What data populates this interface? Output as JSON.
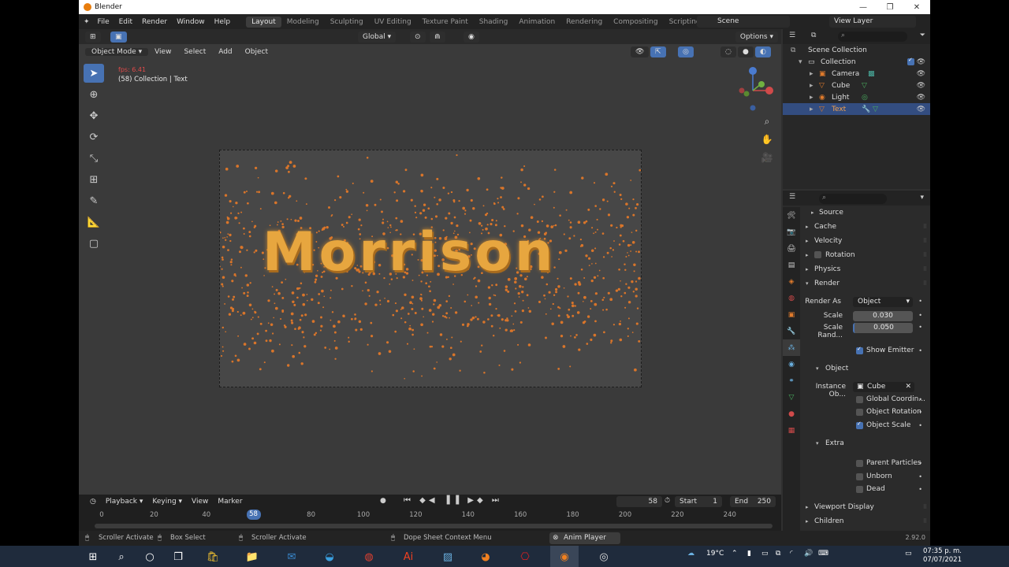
{
  "window": {
    "title": "Blender",
    "controls": [
      "—",
      "❐",
      "✕"
    ]
  },
  "menus": [
    "File",
    "Edit",
    "Render",
    "Window",
    "Help"
  ],
  "workspaces": [
    "Layout",
    "Modeling",
    "Sculpting",
    "UV Editing",
    "Texture Paint",
    "Shading",
    "Animation",
    "Rendering",
    "Compositing",
    "Scripting"
  ],
  "active_workspace": "Layout",
  "scene": "Scene",
  "view_layer": "View Layer",
  "viewport": {
    "transform_orientation": "Global",
    "options_label": "Options",
    "mode": "Object Mode",
    "header_items": [
      "View",
      "Select",
      "Add",
      "Object"
    ],
    "fps": "fps: 6.41",
    "collection_label": "(58) Collection | Text",
    "text_object": "Morrison"
  },
  "outliner": {
    "root": "Scene Collection",
    "collection": "Collection",
    "items": [
      {
        "label": "Camera",
        "color": "#e07b2c"
      },
      {
        "label": "Cube",
        "color": "#e07b2c"
      },
      {
        "label": "Light",
        "color": "#e07b2c"
      },
      {
        "label": "Text",
        "color": "#e07b2c",
        "selected": true
      }
    ]
  },
  "properties": {
    "sections": {
      "source": "Source",
      "cache": "Cache",
      "velocity": "Velocity",
      "rotation": "Rotation",
      "physics": "Physics",
      "render": "Render",
      "object": "Object",
      "extra": "Extra",
      "viewport_display": "Viewport Display",
      "children": "Children"
    },
    "render_as_label": "Render As",
    "render_as_value": "Object",
    "scale_label": "Scale",
    "scale_value": "0.030",
    "scale_rand_label": "Scale Rand...",
    "scale_rand_value": "0.050",
    "show_emitter": "Show Emitter",
    "instance_label": "Instance Ob...",
    "instance_value": "Cube",
    "global_coord": "Global Coordin...",
    "object_rotation": "Object Rotation",
    "object_scale": "Object Scale",
    "parent_particles": "Parent Particles",
    "unborn": "Unborn",
    "dead": "Dead"
  },
  "timeline": {
    "menu": [
      "Playback",
      "Keying",
      "View",
      "Marker"
    ],
    "current_frame": "58",
    "start_label": "Start",
    "start": "1",
    "end_label": "End",
    "end": "250",
    "ticks": [
      "0",
      "20",
      "40",
      "58",
      "80",
      "100",
      "120",
      "140",
      "160",
      "180",
      "200",
      "220",
      "240"
    ]
  },
  "statusbar": {
    "items": [
      "Scroller Activate",
      "Box Select",
      "Scroller Activate",
      "Dope Sheet Context Menu"
    ],
    "anim_player": "Anim Player",
    "version": "2.92.0"
  },
  "taskbar": {
    "weather": "19°C",
    "time": "07:35 p. m.",
    "date": "07/07/2021"
  },
  "colors": {
    "accent": "#4772b3",
    "selected_row": "#334d80",
    "text_orange": "#e7a63f",
    "particle": "#d9752a"
  }
}
